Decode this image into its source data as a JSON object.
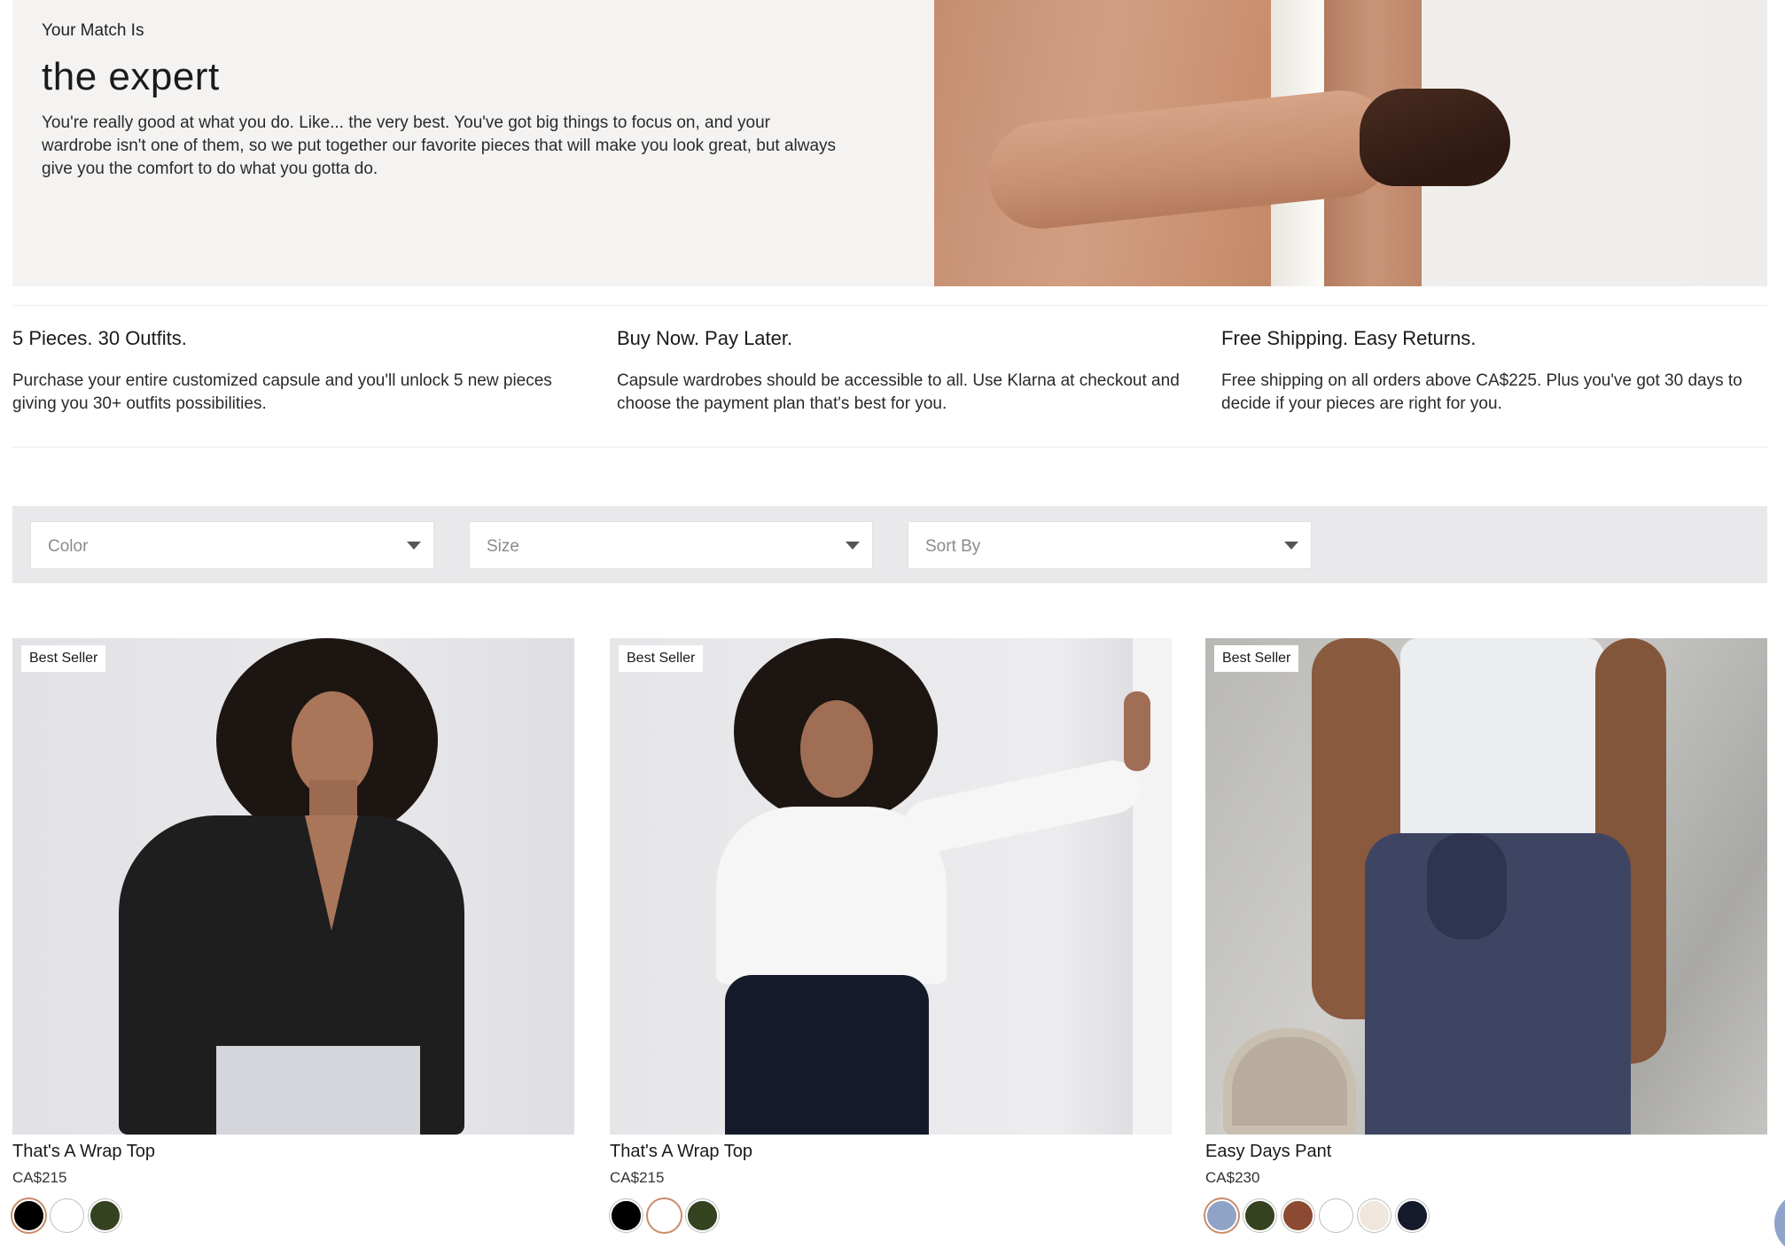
{
  "hero": {
    "kicker": "Your Match Is",
    "title": "the expert",
    "description": "You're really good at what you do. Like... the very best. You've got big things to focus on, and your wardrobe isn't one of them, so we put together our favorite pieces that will make you look great, but always give you the comfort to do what you gotta do."
  },
  "features": [
    {
      "title": "5 Pieces. 30 Outfits.",
      "text": "Purchase your entire customized capsule and you'll unlock 5 new pieces giving you 30+ outfits possibilities."
    },
    {
      "title": "Buy Now. Pay Later.",
      "text": "Capsule wardrobes should be accessible to all. Use Klarna at checkout and choose the payment plan that's best for you."
    },
    {
      "title": "Free Shipping. Easy Returns.",
      "text": "Free shipping on all orders above CA$225. Plus you've got 30 days to decide if your pieces are right for you."
    }
  ],
  "filters": {
    "color": "Color",
    "size": "Size",
    "sort": "Sort By"
  },
  "products": [
    {
      "badge": "Best Seller",
      "name": "That's A Wrap Top",
      "price": "CA$215",
      "swatches": [
        "#000000",
        "#ffffff",
        "#34421f"
      ],
      "selected": 0
    },
    {
      "badge": "Best Seller",
      "name": "That's A Wrap Top",
      "price": "CA$215",
      "swatches": [
        "#000000",
        "#ffffff",
        "#34421f"
      ],
      "selected": 1
    },
    {
      "badge": "Best Seller",
      "name": "Easy Days Pant",
      "price": "CA$230",
      "swatches": [
        "#8fa3c6",
        "#34421f",
        "#8c4a32",
        "#ffffff",
        "#efe7dd",
        "#141a2c"
      ],
      "selected": 0
    }
  ]
}
